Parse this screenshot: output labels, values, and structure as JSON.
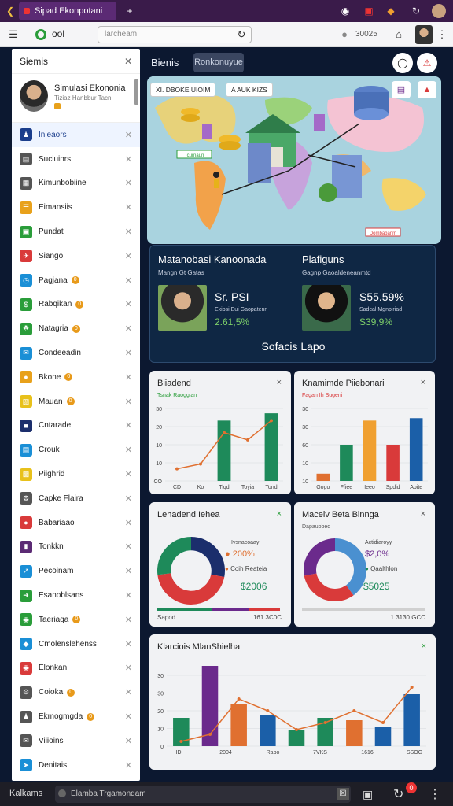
{
  "browser": {
    "tab_title": "Sipad Ekonpotani",
    "new_tab": "+",
    "address_prefix": "ool",
    "search_placeholder": "larcheam",
    "counter": "30025"
  },
  "sidebar": {
    "title": "Siemis",
    "profile_name": "Simulasi Ekononia",
    "profile_sub": "Tiziaz Hanbbur Tacn",
    "items": [
      {
        "label": "Inleaors",
        "icon": "user-icon",
        "color": "#1b3e8c",
        "badge": ""
      },
      {
        "label": "Suciuinrs",
        "icon": "chart-icon",
        "color": "#555",
        "badge": ""
      },
      {
        "label": "Kimunbobiine",
        "icon": "grid-icon",
        "color": "#555",
        "badge": ""
      },
      {
        "label": "Eimansiis",
        "icon": "list-icon",
        "color": "#e8a11b",
        "badge": ""
      },
      {
        "label": "Pundat",
        "icon": "box-icon",
        "color": "#2a9d3a",
        "badge": ""
      },
      {
        "label": "Siango",
        "icon": "plane-icon",
        "color": "#d93a3a",
        "badge": ""
      },
      {
        "label": "Pagjana",
        "icon": "clock-icon",
        "color": "#1a8fd6",
        "badge": "0"
      },
      {
        "label": "Rabqikan",
        "icon": "dollar-icon",
        "color": "#2a9d3a",
        "badge": "0"
      },
      {
        "label": "Natagria",
        "icon": "leaf-icon",
        "color": "#2a9d3a",
        "badge": "0"
      },
      {
        "label": "Condeeadin",
        "icon": "chat-icon",
        "color": "#1a8fd6",
        "badge": ""
      },
      {
        "label": "Bkone",
        "icon": "coin-icon",
        "color": "#e8a11b",
        "badge": "0"
      },
      {
        "label": "Mauan",
        "icon": "wallet-icon",
        "color": "#e8c11b",
        "badge": "0"
      },
      {
        "label": "Cntarade",
        "icon": "square-icon",
        "color": "#1b2e6c",
        "badge": ""
      },
      {
        "label": "Crouk",
        "icon": "doc-icon",
        "color": "#1a8fd6",
        "badge": ""
      },
      {
        "label": "Piighrid",
        "icon": "folder-icon",
        "color": "#e8c11b",
        "badge": ""
      },
      {
        "label": "Capke Flaira",
        "icon": "gear-icon",
        "color": "#555",
        "badge": ""
      },
      {
        "label": "Babariaao",
        "icon": "circle-icon",
        "color": "#d93a3a",
        "badge": ""
      },
      {
        "label": "Tonkkn",
        "icon": "bookmark-icon",
        "color": "#5b2a74",
        "badge": ""
      },
      {
        "label": "Pecoinam",
        "icon": "trend-icon",
        "color": "#1a8fd6",
        "badge": ""
      },
      {
        "label": "Esanoblsans",
        "icon": "arrow-icon",
        "color": "#2a9d3a",
        "badge": ""
      },
      {
        "label": "Taeriaga",
        "icon": "lock-icon",
        "color": "#2a9d3a",
        "badge": "0"
      },
      {
        "label": "Cmolenslehenss",
        "icon": "tag-icon",
        "color": "#1a8fd6",
        "badge": ""
      },
      {
        "label": "Elonkan",
        "icon": "record-icon",
        "color": "#d93a3a",
        "badge": ""
      },
      {
        "label": "Coioka",
        "icon": "cog-icon",
        "color": "#555",
        "badge": "0"
      },
      {
        "label": "Ekmogmgda",
        "icon": "person-icon",
        "color": "#555",
        "badge": "0"
      },
      {
        "label": "Viiioins",
        "icon": "mail-icon",
        "color": "#555",
        "badge": ""
      },
      {
        "label": "Denitais",
        "icon": "pin-icon",
        "color": "#1a8fd6",
        "badge": ""
      }
    ]
  },
  "main": {
    "title": "Bienis",
    "tab": "Ronkonuyue",
    "map_btn_1": "XI. DBOKE UIOIM",
    "map_btn_2": "A AUK KIZS",
    "map_label_1": "Tcurnaun",
    "map_label_2": "Dombabanm"
  },
  "panel": {
    "left_title": "Matanobasi Kanoonada",
    "left_sub": "Mangn Gt Gatas",
    "left_big": "Sr. PSI",
    "left_small": "Ekipsi Eui Gaopatenn",
    "left_pct": "2.61,5%",
    "right_title": "Plafiguns",
    "right_sub": "Gagnp Gaoaldeneanmtd",
    "right_big": "S55.59%",
    "right_small": "Sadcal Mgnpiriad",
    "right_pct": "S39,9%",
    "footer": "Sofacis Lapo"
  },
  "card1": {
    "title": "Biiadend",
    "sub": "Tsnak Raoggian",
    "x": "×",
    "chart_data": {
      "type": "bar",
      "categories": [
        "CD",
        "Ko",
        "Tiqd",
        "Toyia",
        "Tond"
      ],
      "series": [
        {
          "values": [
            null,
            null,
            25,
            null,
            28
          ],
          "color": "#1e8a5a"
        },
        {
          "values": [
            5,
            7,
            20,
            17,
            25
          ],
          "color": "#e07030",
          "kind": "line"
        }
      ],
      "ylim": [
        0,
        30
      ],
      "yticks": [
        "30",
        "20",
        "10",
        "10",
        "CO"
      ]
    }
  },
  "card2": {
    "title": "Knamimde Piiebonari",
    "sub": "Fagan Ih Sugeni",
    "x": "×",
    "chart_data": {
      "type": "bar",
      "categories": [
        "Gogo",
        "Ffiee",
        "Ieeo",
        "Spdid",
        "Abite"
      ],
      "series": [
        {
          "values": [
            3,
            15,
            25,
            15,
            26
          ],
          "colors": [
            "#e07030",
            "#1e8a5a",
            "#f0a030",
            "#d93a3a",
            "#1b5fa8"
          ]
        }
      ],
      "ylim": [
        0,
        30
      ],
      "yticks": [
        "30",
        "30",
        "60",
        "10",
        "10"
      ]
    }
  },
  "card3": {
    "title": "Lehadend Iehea",
    "x": "×",
    "legend_1": "Ivsnacoaay",
    "val_1": "200%",
    "legend_2": "Coih Reateia",
    "val_2": "$2006",
    "foot_left": "Sapod",
    "foot_right": "161.3C0C",
    "chart_data": {
      "type": "pie",
      "values": [
        28,
        45,
        27
      ],
      "colors": [
        "#1b2e6c",
        "#d93a3a",
        "#1e8a5a"
      ]
    }
  },
  "card4": {
    "title": "Macelv Beta Binnga",
    "sub": "Dapauobed",
    "x": "×",
    "legend_1": "Actidiaroyy",
    "val_1": "$2,0%",
    "legend_2": "Qaalthlon",
    "val_2": "$5025",
    "foot_right": "1.3130.GCC",
    "chart_data": {
      "type": "pie",
      "values": [
        40,
        32,
        28
      ],
      "colors": [
        "#4a90d0",
        "#d93a3a",
        "#6b2a8c"
      ]
    }
  },
  "card5": {
    "title": "Klarciois MlanShielha",
    "x": "×",
    "chart_data": {
      "type": "bar",
      "categories": [
        "ID",
        "",
        "2004",
        "",
        "Rapo",
        "",
        "7VKS",
        "",
        "1616",
        "",
        "SSOG"
      ],
      "series": [
        {
          "values": [
            12,
            34,
            18,
            13,
            7,
            12,
            11,
            8,
            22
          ],
          "colors": [
            "#1e8a5a",
            "#6b2a8c",
            "#e07030",
            "#1b5fa8",
            "#1e8a5a",
            "#1e8a5a",
            "#e07030",
            "#1b5fa8",
            "#1b5fa8"
          ]
        },
        {
          "values": [
            2,
            5,
            20,
            15,
            7,
            10,
            15,
            10,
            25
          ],
          "color": "#e07030",
          "kind": "line"
        }
      ],
      "ylim": [
        0,
        30
      ],
      "yticks": [
        "30",
        "30",
        "20",
        "10",
        "0"
      ]
    }
  },
  "bottombar": {
    "left": "Kalkams",
    "status": "Elamba Trgamondam",
    "notif": "0"
  }
}
